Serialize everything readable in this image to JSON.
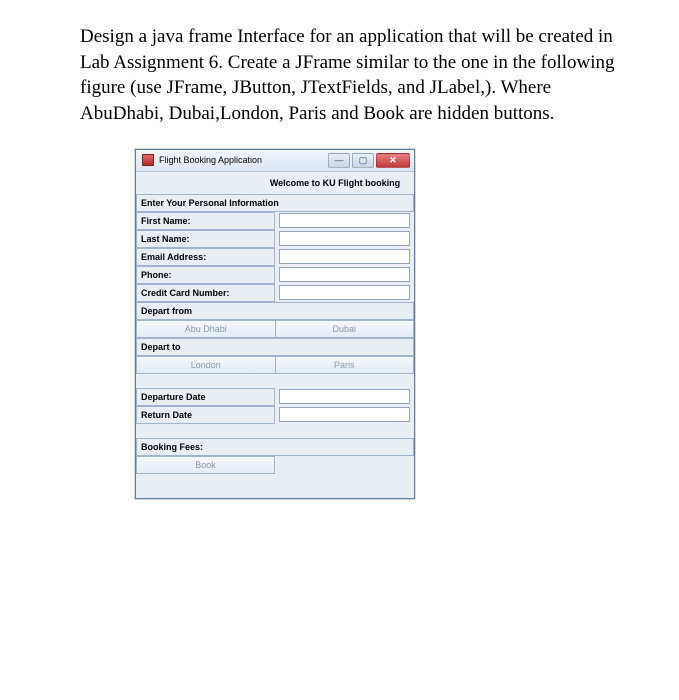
{
  "instructions": "Design a java frame Interface for an application that will be created in Lab Assignment 6. Create a JFrame similar to the one in the following figure (use JFrame, JButton, JTextFields, and JLabel,). Where AbuDhabi, Dubai,London, Paris and Book are hidden buttons.",
  "window": {
    "title": "Flight Booking Application"
  },
  "welcome": "Welcome to KU Flight booking",
  "labels": {
    "section_personal": "Enter Your Personal Information",
    "first_name": "First Name:",
    "last_name": "Last Name:",
    "email": "Email Address:",
    "phone": "Phone:",
    "cc": "Credit Card Number:",
    "depart_from": "Depart from",
    "depart_to": "Depart to",
    "departure_date": "Departure Date",
    "return_date": "Return Date",
    "booking_fees": "Booking Fees:"
  },
  "buttons": {
    "abu_dhabi": "Abu Dhabi",
    "dubai": "Dubai",
    "london": "London",
    "paris": "Paris",
    "book": "Book"
  },
  "fields": {
    "first_name": "",
    "last_name": "",
    "email": "",
    "phone": "",
    "cc": "",
    "departure_date": "",
    "return_date": ""
  }
}
